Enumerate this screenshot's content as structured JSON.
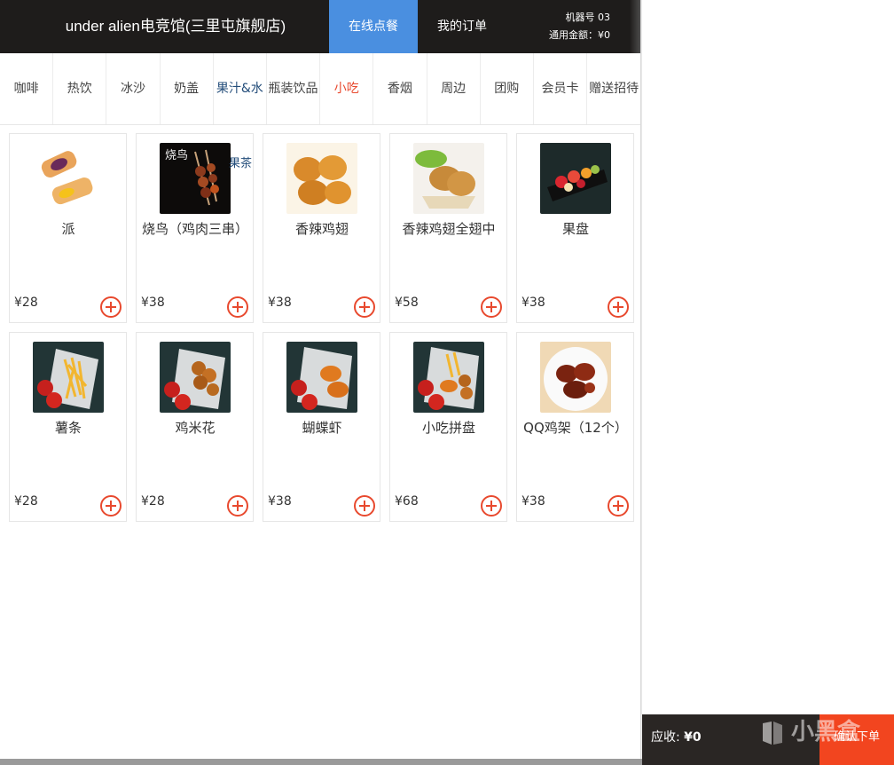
{
  "header": {
    "store_title": "under alien电竞馆(三里屯旗舰店)",
    "tabs": [
      "在线点餐",
      "我的订单"
    ],
    "machine_label": "机器号 03",
    "balance_label": "通用金额：¥0"
  },
  "categories": [
    "咖啡",
    "热饮",
    "冰沙",
    "奶盖",
    "果汁&水",
    "瓶装饮品",
    "小吃",
    "香烟",
    "周边",
    "团购",
    "会员卡",
    "赠送招待"
  ],
  "active_category": "小吃",
  "overflow_label": "果茶",
  "products": [
    {
      "name": "派",
      "price": "¥28"
    },
    {
      "name": "烧鸟（鸡肉三串）",
      "price": "¥38"
    },
    {
      "name": "香辣鸡翅",
      "price": "¥38"
    },
    {
      "name": "香辣鸡翅全翅中",
      "price": "¥58"
    },
    {
      "name": "果盘",
      "price": "¥38"
    },
    {
      "name": "薯条",
      "price": "¥28"
    },
    {
      "name": "鸡米花",
      "price": "¥28"
    },
    {
      "name": "蝴蝶虾",
      "price": "¥38"
    },
    {
      "name": "小吃拼盘",
      "price": "¥68"
    },
    {
      "name": "QQ鸡架（12个）",
      "price": "¥38"
    }
  ],
  "footer": {
    "due_label": "应收:",
    "due_amount": "¥0",
    "confirm_label": "确认下单",
    "watermark_text": "小黑盒"
  },
  "colors": {
    "header_bg": "#1e1c1b",
    "active_tab": "#4a8fe0",
    "accent": "#e8492e",
    "confirm_bg": "#f2451f"
  },
  "icons": [
    "add-to-cart-icon",
    "watermark-logo-icon"
  ]
}
